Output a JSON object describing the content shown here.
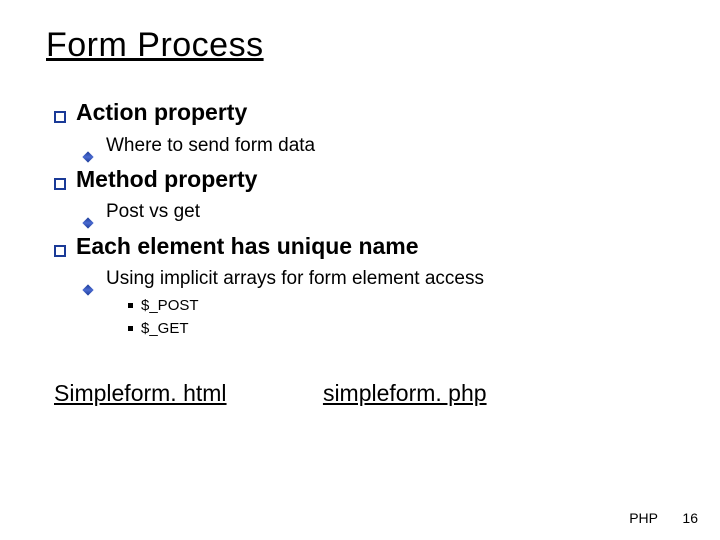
{
  "title": "Form Process",
  "bullets": {
    "a": "Action property",
    "a1": "Where to send form data",
    "b": "Method property",
    "b1": "Post vs get",
    "c": "Each element has unique name",
    "c1": "Using implicit arrays for form element access",
    "c1a": "$_POST",
    "c1b": "$_GET"
  },
  "links": {
    "left": "Simpleform. html",
    "right": "simpleform. php"
  },
  "footer": {
    "label": "PHP",
    "page": "16"
  }
}
